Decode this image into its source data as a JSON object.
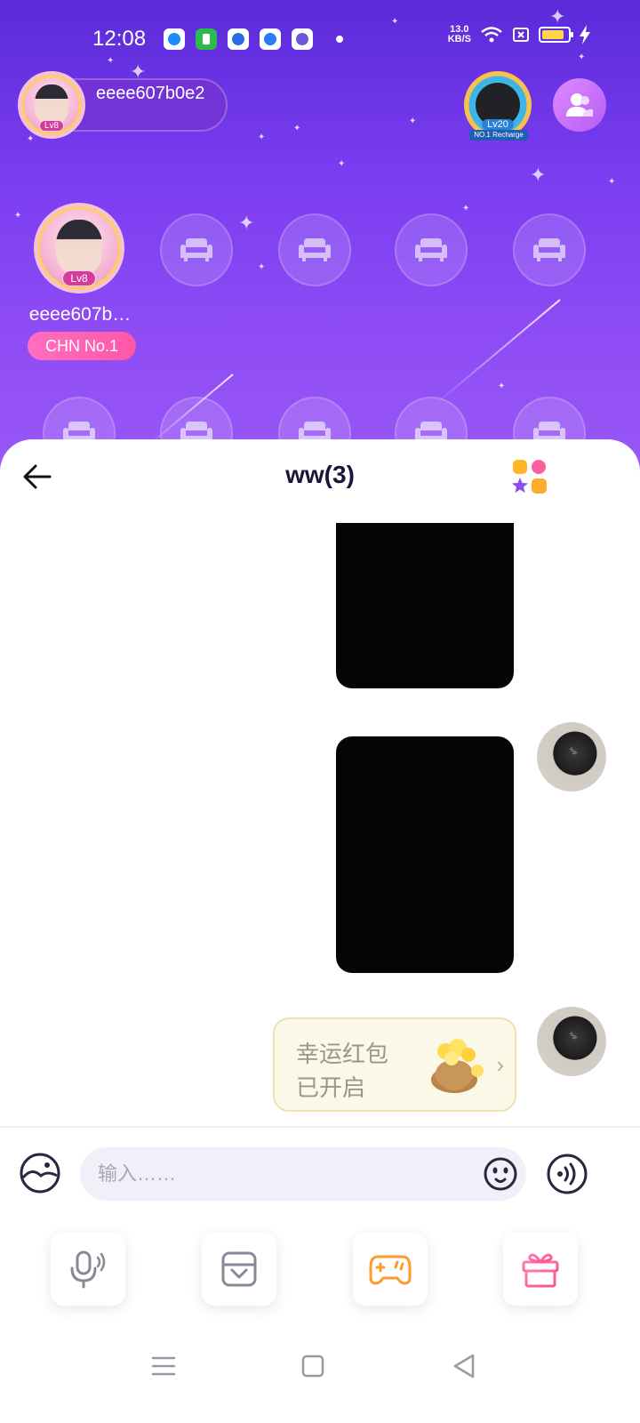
{
  "status_bar": {
    "time": "12:08",
    "speed_value": "13.0",
    "speed_unit": "KB/S",
    "battery_color": "#ffd54a"
  },
  "room": {
    "host_name": "eeee607b0e2",
    "host_level": "Lv8",
    "rank_level": "Lv20",
    "rank_ribbon": "NO.1 Recharge",
    "seat_owner_name": "eeee607b…",
    "seat_owner_level": "Lv8",
    "seat_owner_badge": "CHN No.1",
    "accent_color": "#7a3cf0"
  },
  "chat": {
    "title": "ww(3)",
    "redpack_line1": "幸运红包",
    "redpack_line2": "已开启",
    "input_placeholder": "输入……"
  },
  "icons": {
    "back": "arrow-left-icon",
    "apps": "apps-grid-icon",
    "image": "image-icon",
    "emoji": "emoji-icon",
    "voice": "voice-icon",
    "mic": "mic-icon",
    "package": "package-icon",
    "game": "gamepad-icon",
    "gift": "gift-icon"
  }
}
